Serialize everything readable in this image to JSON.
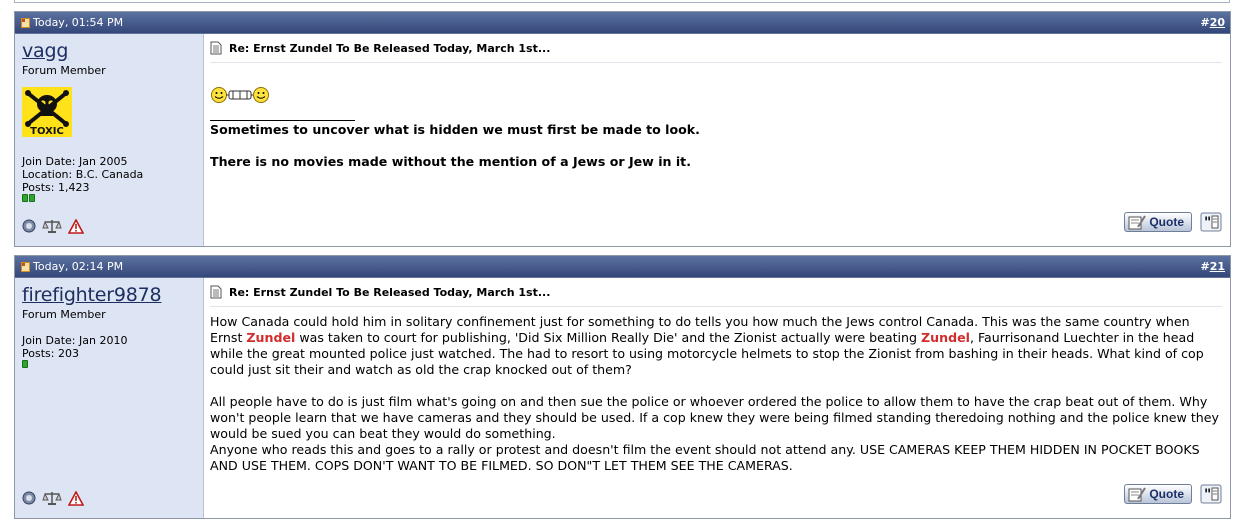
{
  "posts": [
    {
      "date": "Today, 01:54 PM",
      "number_prefix": "#",
      "number": "20",
      "username": "vagg",
      "user_title": "Forum Member",
      "avatar_text": "TOXIC",
      "join_date": "Join Date: Jan 2005",
      "location": "Location: B.C. Canada",
      "posts_count": "Posts: 1,423",
      "title": "Re: Ernst Zundel To Be Released Today, March 1st...",
      "signature_lines": [
        "Sometimes to uncover what is hidden we must first be made to look.",
        "There is no movies made without the mention of a Jews or Jew in it."
      ],
      "quote_label": "Quote"
    },
    {
      "date": "Today, 02:14 PM",
      "number_prefix": "#",
      "number": "21",
      "username": "firefighter9878",
      "user_title": "Forum Member",
      "join_date": "Join Date: Jan 2010",
      "posts_count": "Posts: 203",
      "title": "Re: Ernst Zundel To Be Released Today, March 1st...",
      "message": {
        "p1_a": "How Canada could hold him in solitary confinement just for something to do tells you how much the Jews control Canada. This was the same country when Ernst ",
        "p1_hl1": "Zundel",
        "p1_b": " was taken to court for publishing, 'Did Six Million Really Die' and the Zionist actually were beating ",
        "p1_hl2": "Zundel",
        "p1_c": ", Faurrisonand Luechter in the head while the great mounted police just watched. The had to resort to using motorcycle helmets to stop the Zionist from bashing in their heads. What kind of cop could just sit their and watch as old the crap knocked out of them?",
        "p2": "All people have to do is just film what's going on and then sue the police or whoever ordered the police to allow them to have the crap beat out of them. Why won't people learn that we have cameras and they should be used. If a cop knew they were being filmed standing theredoing nothing and the police knew they would be sued you can beat they would do something.",
        "p3": "Anyone who reads this and goes to a rally or protest and doesn't film the event should not attend any. USE CAMERAS KEEP THEM HIDDEN IN POCKET BOOKS AND USE THEM. COPS DON'T WANT TO BE FILMED. SO DON\"T LET THEM SEE THE CAMERAS."
      },
      "quote_label": "Quote"
    }
  ],
  "colors": {
    "header_top": "#5c72a0",
    "header_bottom": "#33477a",
    "sidebar": "#dde4f3",
    "highlight": "#d22d2d",
    "username": "#1c2f60"
  },
  "icons": [
    "post-status-icon",
    "document-icon",
    "offline-status-icon",
    "reputation-scales-icon",
    "report-warning-icon",
    "smiley-icon",
    "multiquote-icon",
    "quote-icon"
  ]
}
